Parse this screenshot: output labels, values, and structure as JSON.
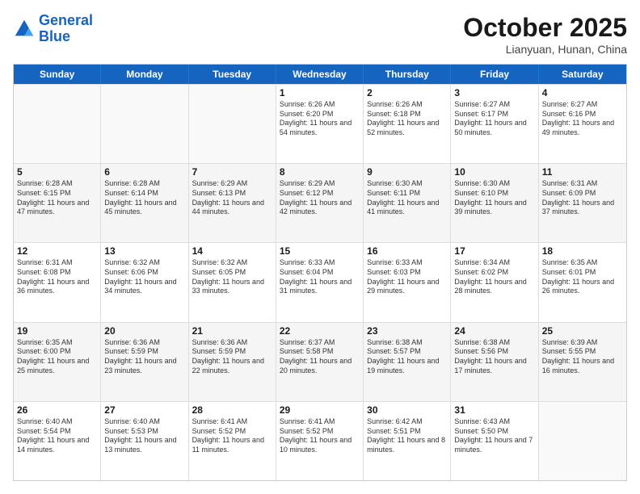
{
  "header": {
    "logo_general": "General",
    "logo_blue": "Blue",
    "month_title": "October 2025",
    "location": "Lianyuan, Hunan, China"
  },
  "days_of_week": [
    "Sunday",
    "Monday",
    "Tuesday",
    "Wednesday",
    "Thursday",
    "Friday",
    "Saturday"
  ],
  "weeks": [
    [
      {
        "day": "",
        "info": ""
      },
      {
        "day": "",
        "info": ""
      },
      {
        "day": "",
        "info": ""
      },
      {
        "day": "1",
        "info": "Sunrise: 6:26 AM\nSunset: 6:20 PM\nDaylight: 11 hours and 54 minutes."
      },
      {
        "day": "2",
        "info": "Sunrise: 6:26 AM\nSunset: 6:18 PM\nDaylight: 11 hours and 52 minutes."
      },
      {
        "day": "3",
        "info": "Sunrise: 6:27 AM\nSunset: 6:17 PM\nDaylight: 11 hours and 50 minutes."
      },
      {
        "day": "4",
        "info": "Sunrise: 6:27 AM\nSunset: 6:16 PM\nDaylight: 11 hours and 49 minutes."
      }
    ],
    [
      {
        "day": "5",
        "info": "Sunrise: 6:28 AM\nSunset: 6:15 PM\nDaylight: 11 hours and 47 minutes."
      },
      {
        "day": "6",
        "info": "Sunrise: 6:28 AM\nSunset: 6:14 PM\nDaylight: 11 hours and 45 minutes."
      },
      {
        "day": "7",
        "info": "Sunrise: 6:29 AM\nSunset: 6:13 PM\nDaylight: 11 hours and 44 minutes."
      },
      {
        "day": "8",
        "info": "Sunrise: 6:29 AM\nSunset: 6:12 PM\nDaylight: 11 hours and 42 minutes."
      },
      {
        "day": "9",
        "info": "Sunrise: 6:30 AM\nSunset: 6:11 PM\nDaylight: 11 hours and 41 minutes."
      },
      {
        "day": "10",
        "info": "Sunrise: 6:30 AM\nSunset: 6:10 PM\nDaylight: 11 hours and 39 minutes."
      },
      {
        "day": "11",
        "info": "Sunrise: 6:31 AM\nSunset: 6:09 PM\nDaylight: 11 hours and 37 minutes."
      }
    ],
    [
      {
        "day": "12",
        "info": "Sunrise: 6:31 AM\nSunset: 6:08 PM\nDaylight: 11 hours and 36 minutes."
      },
      {
        "day": "13",
        "info": "Sunrise: 6:32 AM\nSunset: 6:06 PM\nDaylight: 11 hours and 34 minutes."
      },
      {
        "day": "14",
        "info": "Sunrise: 6:32 AM\nSunset: 6:05 PM\nDaylight: 11 hours and 33 minutes."
      },
      {
        "day": "15",
        "info": "Sunrise: 6:33 AM\nSunset: 6:04 PM\nDaylight: 11 hours and 31 minutes."
      },
      {
        "day": "16",
        "info": "Sunrise: 6:33 AM\nSunset: 6:03 PM\nDaylight: 11 hours and 29 minutes."
      },
      {
        "day": "17",
        "info": "Sunrise: 6:34 AM\nSunset: 6:02 PM\nDaylight: 11 hours and 28 minutes."
      },
      {
        "day": "18",
        "info": "Sunrise: 6:35 AM\nSunset: 6:01 PM\nDaylight: 11 hours and 26 minutes."
      }
    ],
    [
      {
        "day": "19",
        "info": "Sunrise: 6:35 AM\nSunset: 6:00 PM\nDaylight: 11 hours and 25 minutes."
      },
      {
        "day": "20",
        "info": "Sunrise: 6:36 AM\nSunset: 5:59 PM\nDaylight: 11 hours and 23 minutes."
      },
      {
        "day": "21",
        "info": "Sunrise: 6:36 AM\nSunset: 5:59 PM\nDaylight: 11 hours and 22 minutes."
      },
      {
        "day": "22",
        "info": "Sunrise: 6:37 AM\nSunset: 5:58 PM\nDaylight: 11 hours and 20 minutes."
      },
      {
        "day": "23",
        "info": "Sunrise: 6:38 AM\nSunset: 5:57 PM\nDaylight: 11 hours and 19 minutes."
      },
      {
        "day": "24",
        "info": "Sunrise: 6:38 AM\nSunset: 5:56 PM\nDaylight: 11 hours and 17 minutes."
      },
      {
        "day": "25",
        "info": "Sunrise: 6:39 AM\nSunset: 5:55 PM\nDaylight: 11 hours and 16 minutes."
      }
    ],
    [
      {
        "day": "26",
        "info": "Sunrise: 6:40 AM\nSunset: 5:54 PM\nDaylight: 11 hours and 14 minutes."
      },
      {
        "day": "27",
        "info": "Sunrise: 6:40 AM\nSunset: 5:53 PM\nDaylight: 11 hours and 13 minutes."
      },
      {
        "day": "28",
        "info": "Sunrise: 6:41 AM\nSunset: 5:52 PM\nDaylight: 11 hours and 11 minutes."
      },
      {
        "day": "29",
        "info": "Sunrise: 6:41 AM\nSunset: 5:52 PM\nDaylight: 11 hours and 10 minutes."
      },
      {
        "day": "30",
        "info": "Sunrise: 6:42 AM\nSunset: 5:51 PM\nDaylight: 11 hours and 8 minutes."
      },
      {
        "day": "31",
        "info": "Sunrise: 6:43 AM\nSunset: 5:50 PM\nDaylight: 11 hours and 7 minutes."
      },
      {
        "day": "",
        "info": ""
      }
    ]
  ]
}
